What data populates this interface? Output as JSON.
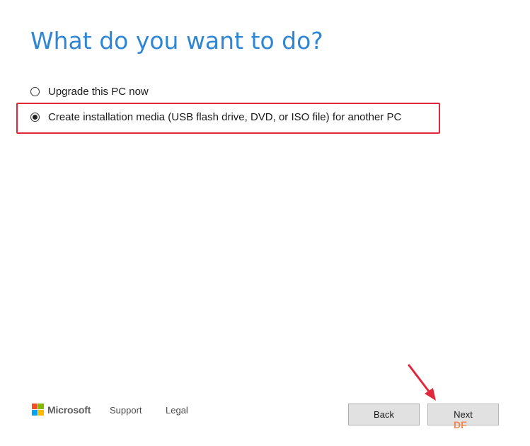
{
  "title": "What do you want to do?",
  "options": [
    {
      "label": "Upgrade this PC now",
      "selected": false
    },
    {
      "label": "Create installation media (USB flash drive, DVD, or ISO file) for another PC",
      "selected": true
    }
  ],
  "footer": {
    "brand": "Microsoft",
    "links": {
      "support": "Support",
      "legal": "Legal"
    }
  },
  "buttons": {
    "back": "Back",
    "next": "Next"
  },
  "annotation": {
    "highlight_color": "#e0283a",
    "arrow_color": "#e0283a"
  },
  "watermark": "DF",
  "colors": {
    "title": "#2f86d4",
    "button_bg": "#e1e1e1"
  }
}
